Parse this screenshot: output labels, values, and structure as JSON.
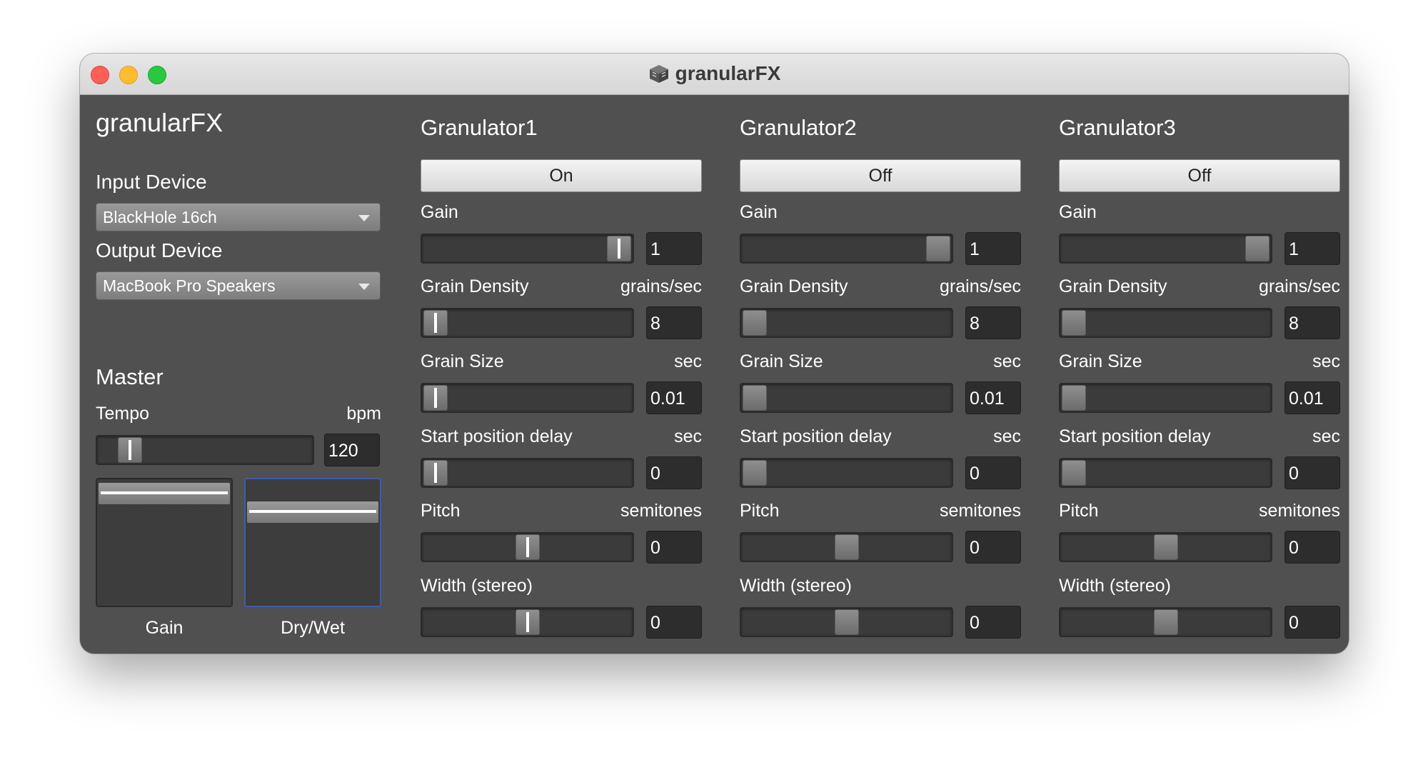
{
  "window": {
    "title": "granularFX"
  },
  "left": {
    "app_title": "granularFX",
    "input_device_label": "Input Device",
    "input_device_value": "BlackHole 16ch",
    "output_device_label": "Output Device",
    "output_device_value": "MacBook Pro Speakers",
    "master_heading": "Master",
    "tempo_label": "Tempo",
    "tempo_unit": "bpm",
    "tempo_value": "120",
    "tempo_level": 0.1,
    "gain_caption": "Gain",
    "gain_level": 0.98,
    "drywet_caption": "Dry/Wet",
    "drywet_level": 0.8
  },
  "granulators": [
    {
      "title": "Granulator1",
      "toggle": "On",
      "active": true,
      "params": [
        {
          "label": "Gain",
          "unit": "",
          "value": "1",
          "level": 1.0
        },
        {
          "label": "Grain Density",
          "unit": "grains/sec",
          "value": "8",
          "level": 0.0
        },
        {
          "label": "Grain Size",
          "unit": "sec",
          "value": "0.01",
          "level": 0.0
        },
        {
          "label": "Start position delay",
          "unit": "sec",
          "value": "0",
          "level": 0.0
        },
        {
          "label": "Pitch",
          "unit": "semitones",
          "value": "0",
          "level": 0.5
        },
        {
          "label": "Width (stereo)",
          "unit": "",
          "value": "0",
          "level": 0.5
        }
      ]
    },
    {
      "title": "Granulator2",
      "toggle": "Off",
      "active": false,
      "params": [
        {
          "label": "Gain",
          "unit": "",
          "value": "1",
          "level": 1.0
        },
        {
          "label": "Grain Density",
          "unit": "grains/sec",
          "value": "8",
          "level": 0.0
        },
        {
          "label": "Grain Size",
          "unit": "sec",
          "value": "0.01",
          "level": 0.0
        },
        {
          "label": "Start position delay",
          "unit": "sec",
          "value": "0",
          "level": 0.0
        },
        {
          "label": "Pitch",
          "unit": "semitones",
          "value": "0",
          "level": 0.5
        },
        {
          "label": "Width (stereo)",
          "unit": "",
          "value": "0",
          "level": 0.5
        }
      ]
    },
    {
      "title": "Granulator3",
      "toggle": "Off",
      "active": false,
      "params": [
        {
          "label": "Gain",
          "unit": "",
          "value": "1",
          "level": 1.0
        },
        {
          "label": "Grain Density",
          "unit": "grains/sec",
          "value": "8",
          "level": 0.0
        },
        {
          "label": "Grain Size",
          "unit": "sec",
          "value": "0.01",
          "level": 0.0
        },
        {
          "label": "Start position delay",
          "unit": "sec",
          "value": "0",
          "level": 0.0
        },
        {
          "label": "Pitch",
          "unit": "semitones",
          "value": "0",
          "level": 0.5
        },
        {
          "label": "Width (stereo)",
          "unit": "",
          "value": "0",
          "level": 0.5
        }
      ]
    }
  ]
}
